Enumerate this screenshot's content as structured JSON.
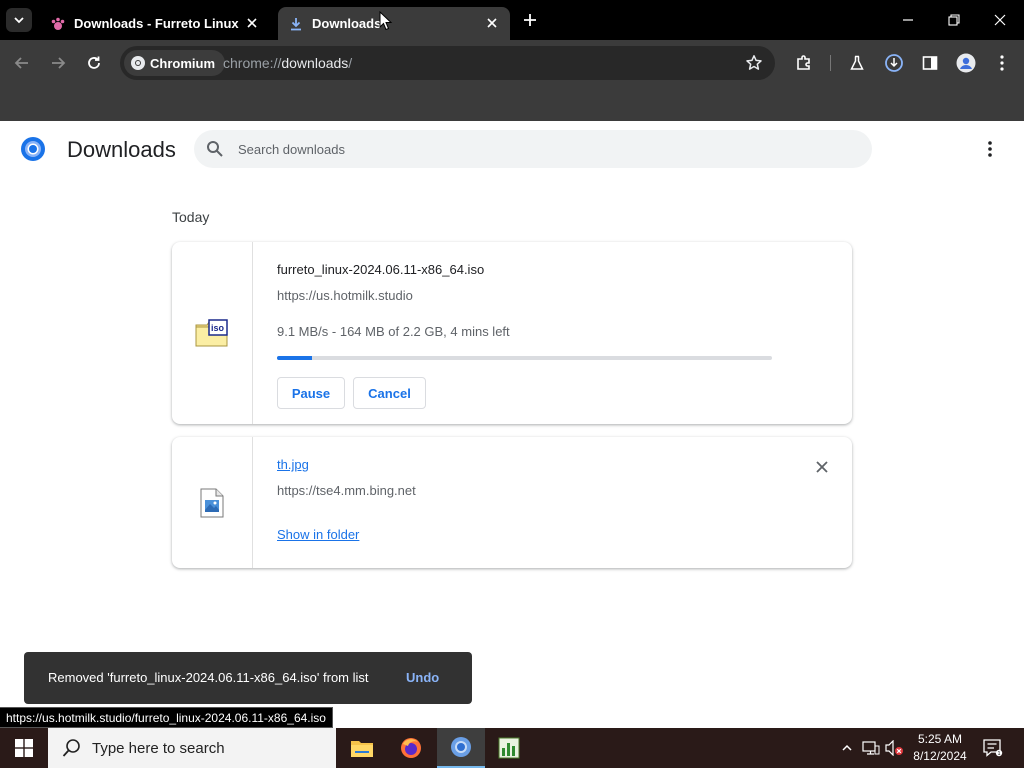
{
  "colors": {
    "accent": "#1a73e8",
    "toast_bg": "#323232",
    "undo": "#8ab4f8",
    "progress_track": "#dadce0"
  },
  "tabs": [
    {
      "title": "Downloads - Furreto Linux",
      "icon": "paw-icon",
      "active": false
    },
    {
      "title": "Downloads",
      "icon": "download-icon",
      "active": true
    }
  ],
  "toolbar": {
    "site_chip": "Chromium",
    "url_scheme": "chrome://",
    "url_host": "downloads",
    "url_rest": "/"
  },
  "page": {
    "title": "Downloads",
    "search_placeholder": "Search downloads",
    "date_header": "Today"
  },
  "downloads": [
    {
      "file_name": "furreto_linux-2024.06.11-x86_64.iso",
      "url": "https://us.hotmilk.studio",
      "status": "9.1 MB/s - 164 MB of 2.2 GB, 4 mins left",
      "progress": 0.07,
      "icon": "iso-file-icon",
      "pause_label": "Pause",
      "cancel_label": "Cancel"
    },
    {
      "file_name": "th.jpg",
      "url": "https://tse4.mm.bing.net",
      "icon": "image-file-icon",
      "action_label": "Show in folder"
    }
  ],
  "toast": {
    "message": "Removed 'furreto_linux-2024.06.11-x86_64.iso' from list",
    "undo_label": "Undo"
  },
  "status_url": "https://us.hotmilk.studio/furreto_linux-2024.06.11-x86_64.iso",
  "taskbar": {
    "search_placeholder": "Type here to search",
    "apps": [
      "file-explorer-icon",
      "firefox-icon",
      "chromium-icon",
      "task-manager-icon"
    ],
    "time": "5:25 AM",
    "date": "8/12/2024"
  }
}
